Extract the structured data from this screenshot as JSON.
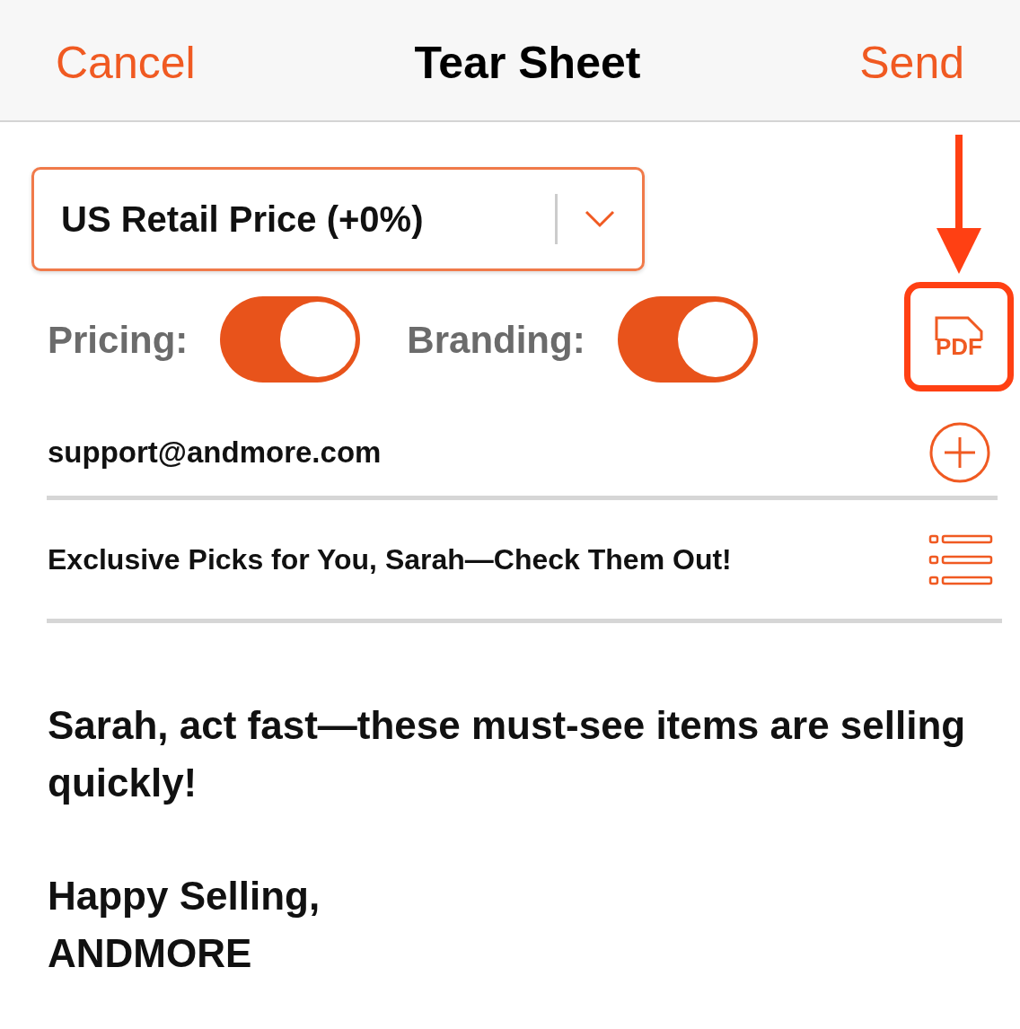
{
  "header": {
    "cancel": "Cancel",
    "title": "Tear Sheet",
    "send": "Send"
  },
  "price_select": {
    "value": "US Retail Price (+0%)"
  },
  "toggles": [
    {
      "label": "Pricing:",
      "on": true
    },
    {
      "label": "Branding:",
      "on": true
    }
  ],
  "pdf_button": {
    "label": "PDF"
  },
  "email": {
    "value": "support@andmore.com"
  },
  "subject": {
    "value": "Exclusive Picks for You, Sarah—Check Them Out!"
  },
  "message": {
    "paragraphs": [
      "Sarah, act fast—these must-see items are selling quickly!",
      "Happy Selling,\nANDMORE"
    ]
  }
}
